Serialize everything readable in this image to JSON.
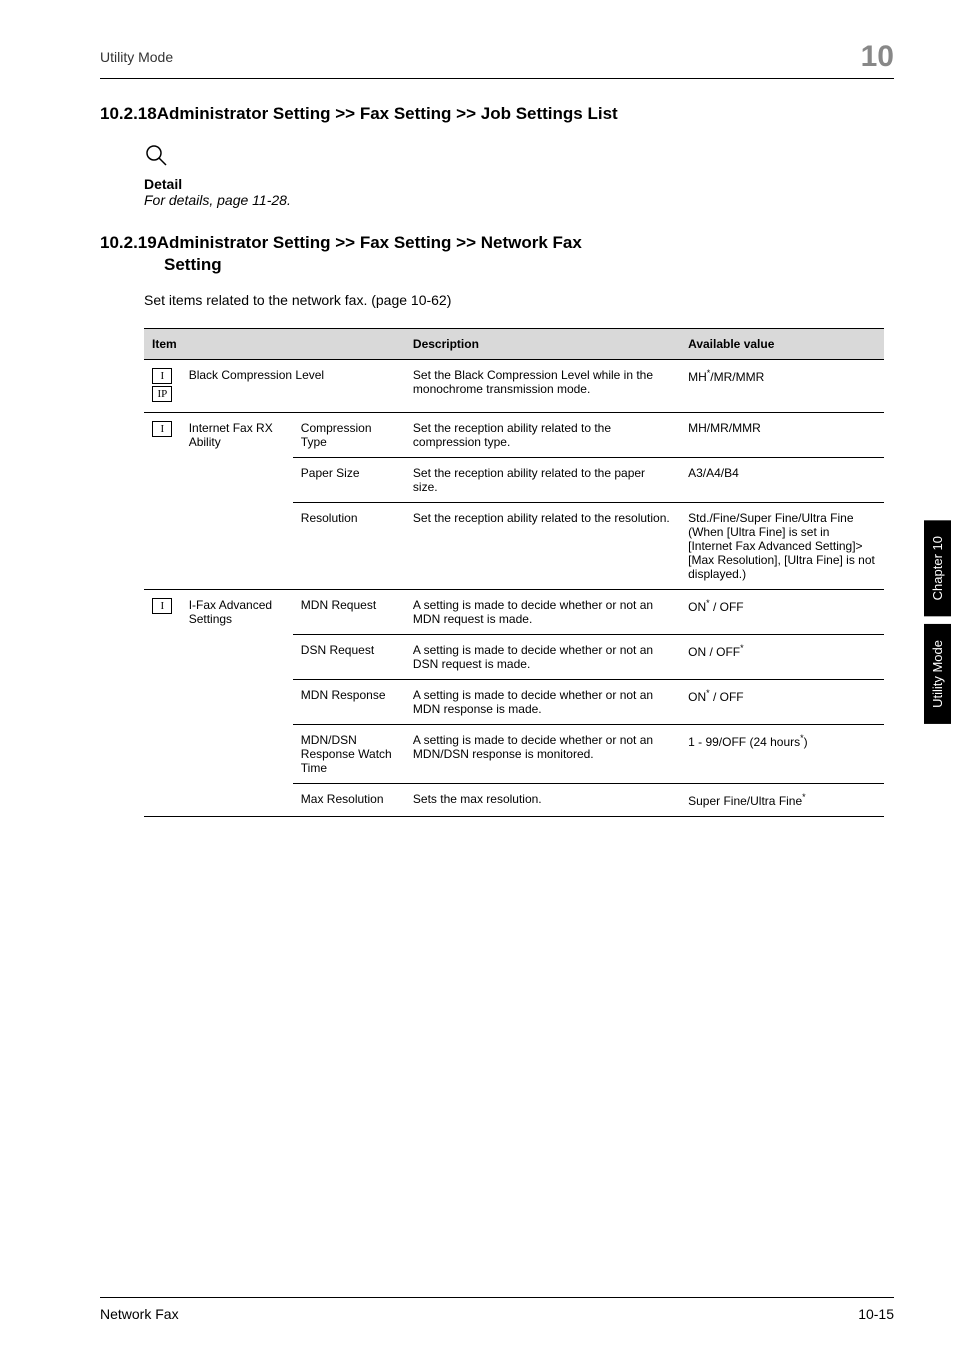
{
  "header": {
    "left": "Utility Mode",
    "right": "10"
  },
  "section1": {
    "num": "10.2.18",
    "title": "Administrator Setting >> Fax Setting >> Job Settings List",
    "detail_label": "Detail",
    "detail_text": "For details, page 11-28."
  },
  "section2": {
    "num": "10.2.19",
    "title_line1": "Administrator Setting >> Fax Setting >> Network Fax",
    "title_line2": "Setting",
    "body": "Set items related to the network fax. (page 10-62)"
  },
  "table": {
    "headers": {
      "item": "Item",
      "desc": "Description",
      "avail": "Available value"
    },
    "rows": {
      "r1": {
        "icons_i": "I",
        "icons_ip": "IP",
        "item": "Black Compression Level",
        "desc": "Set the Black Compression Level while in the monochrome transmission mode.",
        "avail_pre": "MH",
        "avail_sup": "*",
        "avail_post": "/MR/MMR"
      },
      "r2": {
        "icon": "I",
        "item1": "Internet Fax RX Ability",
        "sub1": {
          "item2": "Compression Type",
          "desc": "Set the reception ability related to the compression type.",
          "avail": "MH/MR/MMR"
        },
        "sub2": {
          "item2": "Paper Size",
          "desc": "Set the reception ability related to the paper size.",
          "avail": "A3/A4/B4"
        },
        "sub3": {
          "item2": "Resolution",
          "desc": "Set the reception ability related to the resolution.",
          "avail": "Std./Fine/Super Fine/Ultra Fine\n(When [Ultra Fine] is set in [Internet Fax Advanced Setting]>[Max Resolution], [Ultra Fine] is not displayed.)"
        }
      },
      "r3": {
        "icon": "I",
        "item1": "I-Fax Advanced Settings",
        "sub1": {
          "item2": "MDN Request",
          "desc": "A setting is made to decide whether or not an MDN request is made.",
          "avail_pre": "ON",
          "avail_sup": "*",
          "avail_post": " / OFF"
        },
        "sub2": {
          "item2": "DSN Request",
          "desc": "A setting is made to decide whether or not an DSN request is made.",
          "avail_pre": "ON / OFF",
          "avail_sup": "*"
        },
        "sub3": {
          "item2": "MDN Response",
          "desc": "A setting is made to decide whether or not an MDN response is made.",
          "avail_pre": "ON",
          "avail_sup": "*",
          "avail_post": " / OFF"
        },
        "sub4": {
          "item2": "MDN/DSN Response Watch Time",
          "desc": "A setting is made to decide whether or not an MDN/DSN response is monitored.",
          "avail_pre": "1 - 99/OFF (24 hours",
          "avail_sup": "*",
          "avail_post": ")"
        },
        "sub5": {
          "item2": "Max Resolution",
          "desc": "Sets the max resolution.",
          "avail_pre": "Super Fine/Ultra Fine",
          "avail_sup": "*"
        }
      }
    }
  },
  "side_tabs": {
    "tab1": "Chapter 10",
    "tab2": "Utility Mode"
  },
  "footer": {
    "left": "Network Fax",
    "right": "10-15"
  }
}
